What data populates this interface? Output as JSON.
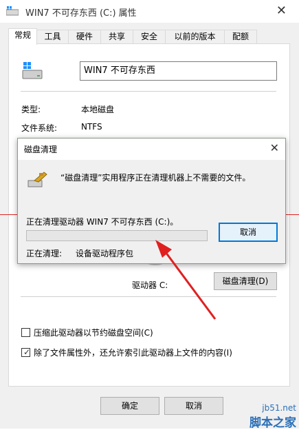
{
  "window": {
    "title": "WIN7 不可存东西 (C:) 属性",
    "close_glyph": "✕"
  },
  "tabs": [
    "常规",
    "工具",
    "硬件",
    "共享",
    "安全",
    "以前的版本",
    "配额"
  ],
  "general": {
    "drive_name": "WIN7 不可存东西",
    "type_label": "类型:",
    "type_value": "本地磁盘",
    "fs_label": "文件系统:",
    "fs_value": "NTFS",
    "drive_label": "驱动器 C:",
    "cleanup_button": "磁盘清理(D)",
    "compress_label": "压缩此驱动器以节约磁盘空间(C)",
    "compress_checked": false,
    "index_label": "除了文件属性外，还允许索引此驱动器上文件的内容(I)",
    "index_checked": true
  },
  "buttons": {
    "ok": "确定",
    "cancel": "取消"
  },
  "cleanup_dialog": {
    "title": "磁盘清理",
    "close_glyph": "✕",
    "message": "“磁盘清理”实用程序正在清理机器上不需要的文件。",
    "progress_label": "正在清理驱动器 WIN7 不可存东西 (C:)。",
    "progress_fraction": 0,
    "cancel_button": "取消",
    "status_label": "正在清理:",
    "status_value": "设备驱动程序包"
  },
  "watermark": {
    "site": "jb51.net",
    "brand": "脚本之家"
  },
  "colors": {
    "accent": "#0078d7",
    "annotation": "#e02020"
  }
}
